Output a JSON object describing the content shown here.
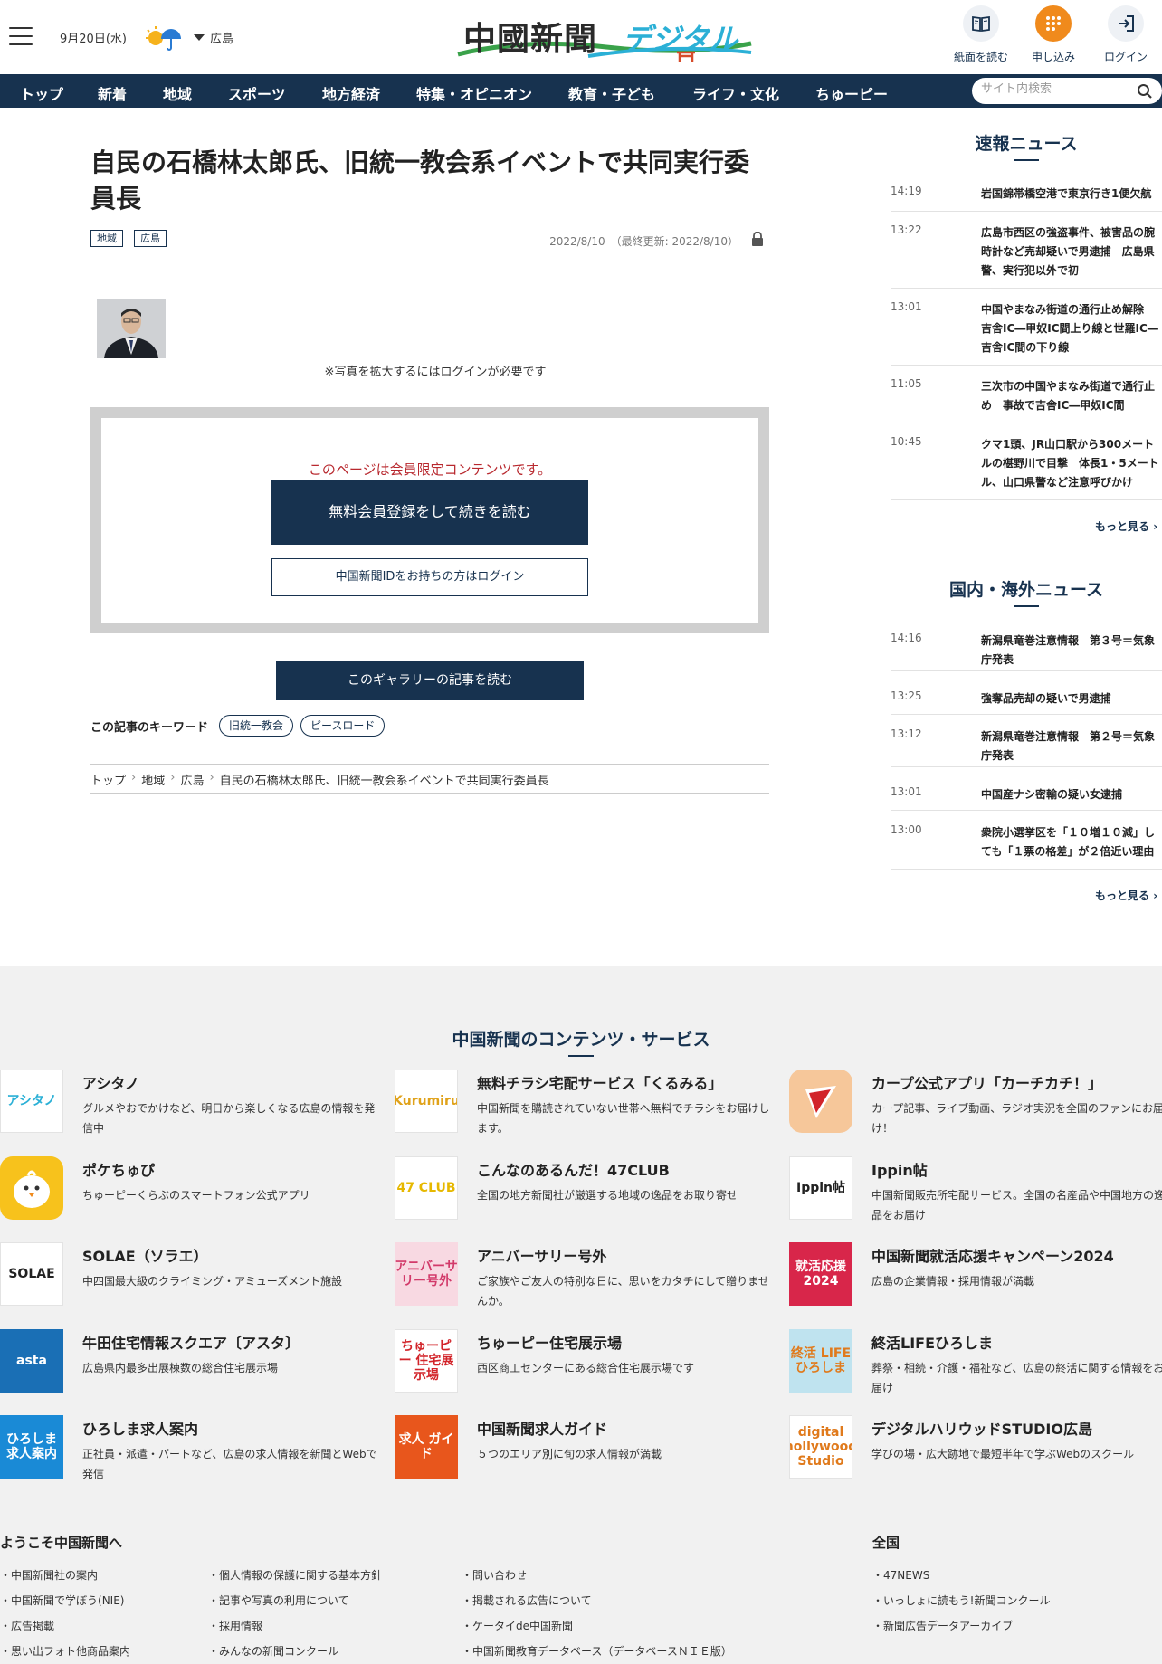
{
  "header": {
    "date": "9月20日(水)",
    "region": "広島",
    "logo_main": "中國新聞",
    "logo_sub": "デジタル",
    "buttons": {
      "read_paper": "紙面を読む",
      "apply": "申し込み",
      "login": "ログイン"
    }
  },
  "nav": {
    "items": [
      "トップ",
      "新着",
      "地域",
      "スポーツ",
      "地方経済",
      "特集・オピニオン",
      "教育・子ども",
      "ライフ・文化",
      "ちゅーピー"
    ],
    "search_placeholder": "サイト内検索"
  },
  "article": {
    "title": "自民の石橋林太郎氏、旧統一教会系イベントで共同実行委員長",
    "tags": [
      "地域",
      "広島"
    ],
    "date": "2022/8/10　（最終更新: 2022/8/10）",
    "photo_caption": "※写真を拡大するにはログインが必要です",
    "paywall": {
      "message": "このページは会員限定コンテンツです。",
      "register": "無料会員登録をして続きを読む",
      "login": "中国新聞IDをお持ちの方はログイン"
    },
    "gallery_button": "このギャラリーの記事を読む",
    "keywords_label": "この記事のキーワード",
    "keywords": [
      "旧統一教会",
      "ピースロード"
    ],
    "breadcrumb": [
      "トップ",
      "地域",
      "広島",
      "自民の石橋林太郎氏、旧統一教会系イベントで共同実行委員長"
    ]
  },
  "sidebar": {
    "breaking": {
      "title": "速報ニュース",
      "items": [
        {
          "time": "14:19",
          "text": "岩国錦帯橋空港で東京行き1便欠航"
        },
        {
          "time": "13:22",
          "text": "広島市西区の強盗事件、被害品の腕時計など売却疑いで男逮捕　広島県警、実行犯以外で初"
        },
        {
          "time": "13:01",
          "text": "中国やまなみ街道の通行止め解除　吉舎IC―甲奴IC間上り線と世羅IC―吉舎IC間の下り線"
        },
        {
          "time": "11:05",
          "text": "三次市の中国やまなみ街道で通行止め　事故で吉舎IC―甲奴IC間"
        },
        {
          "time": "10:45",
          "text": "クマ1頭、JR山口駅から300メートルの椹野川で目撃　体長1・5メートル、山口県警など注意呼びかけ"
        }
      ],
      "more": "もっと見る"
    },
    "world": {
      "title": "国内・海外ニュース",
      "items": [
        {
          "time": "14:16",
          "text": "新潟県竜巻注意情報　第３号＝気象庁発表"
        },
        {
          "time": "13:25",
          "text": "強奪品売却の疑いで男逮捕"
        },
        {
          "time": "13:12",
          "text": "新潟県竜巻注意情報　第２号＝気象庁発表"
        },
        {
          "time": "13:01",
          "text": "中国産ナシ密輸の疑い女逮捕"
        },
        {
          "time": "13:00",
          "text": "衆院小選挙区を「１０増１０減」しても「１票の格差」が２倍近い理由"
        }
      ],
      "more": "もっと見る"
    }
  },
  "services": {
    "title": "中国新聞のコンテンツ・サービス",
    "items": [
      {
        "name": "アシタノ",
        "desc": "グルメやおでかけなど、明日から楽しくなる広島の情報を発信中",
        "icon_text": "アシタノ",
        "icon_bg": "#ffffff",
        "icon_fg": "#2bb0d6"
      },
      {
        "name": "無料チラシ宅配サービス「くるみる」",
        "desc": "中国新聞を購読されていない世帯へ無料でチラシをお届けします。",
        "icon_text": "Kurumiru",
        "icon_bg": "#ffffff",
        "icon_fg": "#e0a21a"
      },
      {
        "name": "カープ公式アプリ「カーチカチ！」",
        "desc": "カープ記事、ライブ動画、ラジオ実況を全国のファンにお届け！",
        "icon_text": "",
        "icon_bg": "#f6c79a",
        "icon_fg": "#d2242a"
      },
      {
        "name": "ポケちゅぴ",
        "desc": "ちゅーピーくらぶのスマートフォン公式アプリ",
        "icon_text": "",
        "icon_bg": "#f7c21c",
        "icon_fg": "#ffffff"
      },
      {
        "name": "こんなのあるんだ！47CLUB",
        "desc": "全国の地方新聞社が厳選する地域の逸品をお取り寄せ",
        "icon_text": "47 CLUB",
        "icon_bg": "#ffffff",
        "icon_fg": "#e6b800"
      },
      {
        "name": "Ippin帖",
        "desc": "中国新聞販売所宅配サービス。全国の名産品や中国地方の逸品をお届け",
        "icon_text": "Ippin帖",
        "icon_bg": "#ffffff",
        "icon_fg": "#222222"
      },
      {
        "name": "SOLAE（ソラエ）",
        "desc": "中四国最大級のクライミング・アミューズメント施設",
        "icon_text": "SOLAE",
        "icon_bg": "#ffffff",
        "icon_fg": "#222222"
      },
      {
        "name": "アニバーサリー号外",
        "desc": "ご家族やご友人の特別な日に、思いをカタチにして贈りませんか。",
        "icon_text": "アニバーサリー号外",
        "icon_bg": "#f8d9e2",
        "icon_fg": "#d23a6a"
      },
      {
        "name": "中国新聞就活応援キャンペーン2024",
        "desc": "広島の企業情報・採用情報が満載",
        "icon_text": "就活応援 2024",
        "icon_bg": "#d8264a",
        "icon_fg": "#ffffff"
      },
      {
        "name": "牛田住宅情報スクエア〔アスタ〕",
        "desc": "広島県内最多出展棟数の総合住宅展示場",
        "icon_text": "asta",
        "icon_bg": "#1a6fb5",
        "icon_fg": "#ffffff"
      },
      {
        "name": "ちゅーピー住宅展示場",
        "desc": "西区商工センターにある総合住宅展示場です",
        "icon_text": "ちゅーピー 住宅展示場",
        "icon_bg": "#ffffff",
        "icon_fg": "#d2242a"
      },
      {
        "name": "終活LIFEひろしま",
        "desc": "葬祭・相続・介護・福祉など、広島の終活に関する情報をお届け",
        "icon_text": "終活 LIFE ひろしま",
        "icon_bg": "#bfe3ef",
        "icon_fg": "#e07a1c"
      },
      {
        "name": "ひろしま求人案内",
        "desc": "正社員・派遣・パートなど、広島の求人情報を新聞とWebで発信",
        "icon_text": "ひろしま 求人案内",
        "icon_bg": "#1a8ad6",
        "icon_fg": "#ffffff"
      },
      {
        "name": "中国新聞求人ガイド",
        "desc": "５つのエリア別に旬の求人情報が満載",
        "icon_text": "求人 ガイド",
        "icon_bg": "#e8561c",
        "icon_fg": "#ffffff"
      },
      {
        "name": "デジタルハリウッドSTUDIO広島",
        "desc": "学びの場・広大跡地で最短半年で学ぶWebのスクール",
        "icon_text": "digital hollywood Studio",
        "icon_bg": "#ffffff",
        "icon_fg": "#e07a1c"
      }
    ]
  },
  "footer": {
    "welcome_title": "ようこそ中国新聞へ",
    "national_title": "全国",
    "col1": [
      "中国新聞社の案内",
      "中国新聞で学ぼう(NIE)",
      "広告掲載",
      "思い出フォト他商品案内"
    ],
    "col2": [
      "個人情報の保護に関する基本方針",
      "記事や写真の利用について",
      "採用情報",
      "みんなの新聞コンクール"
    ],
    "col3": [
      "問い合わせ",
      "掲載される広告について",
      "ケータイde中国新聞",
      "中国新聞教育データベース（データベースＮＩＥ版）"
    ],
    "col4": [
      "47NEWS",
      "いっしょに読もう!新聞コンクール",
      "新聞広告データアーカイブ"
    ]
  }
}
